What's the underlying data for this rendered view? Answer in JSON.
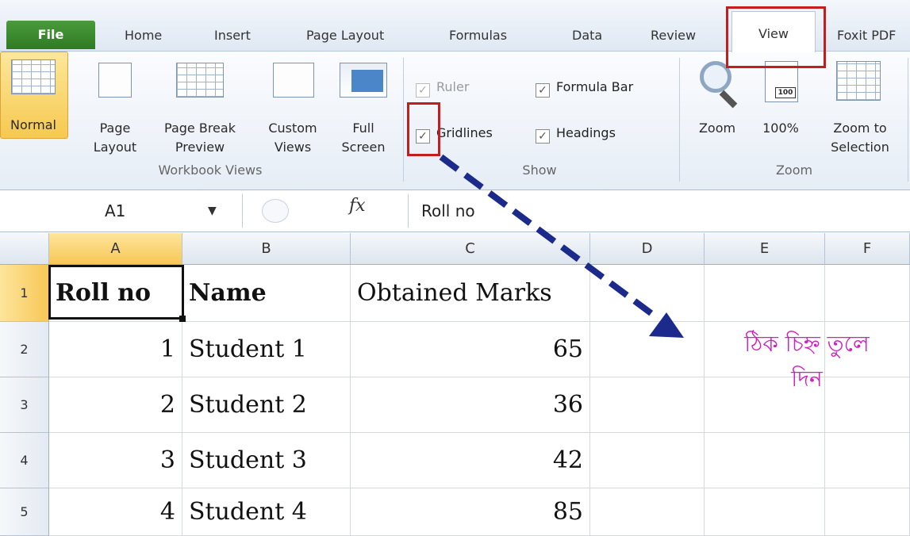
{
  "tabs": {
    "file": "File",
    "home": "Home",
    "insert": "Insert",
    "page_layout": "Page Layout",
    "formulas": "Formulas",
    "data": "Data",
    "review": "Review",
    "view": "View",
    "foxit": "Foxit PDF"
  },
  "ribbon": {
    "workbook_views": {
      "group_label": "Workbook Views",
      "normal": "Normal",
      "page_layout_1": "Page",
      "page_layout_2": "Layout",
      "page_break_1": "Page Break",
      "page_break_2": "Preview",
      "custom_1": "Custom",
      "custom_2": "Views",
      "full_1": "Full",
      "full_2": "Screen"
    },
    "show": {
      "group_label": "Show",
      "ruler": "Ruler",
      "formula_bar": "Formula Bar",
      "gridlines": "Gridlines",
      "headings": "Headings",
      "check_mark": "✓"
    },
    "zoom": {
      "group_label": "Zoom",
      "zoom": "Zoom",
      "hundred": "100%",
      "hundred_icon_text": "100",
      "zoom_sel_1": "Zoom to",
      "zoom_sel_2": "Selection"
    }
  },
  "formula_bar": {
    "name_box": "A1",
    "fx": "fx",
    "value": "Roll no"
  },
  "sheet": {
    "columns": [
      "A",
      "B",
      "C",
      "D",
      "E",
      "F"
    ],
    "rows": [
      "1",
      "2",
      "3",
      "4",
      "5"
    ],
    "header_row": [
      "Roll no",
      "Name",
      "Obtained Marks"
    ],
    "data": [
      [
        "1",
        "Student 1",
        "65"
      ],
      [
        "2",
        "Student 2",
        "36"
      ],
      [
        "3",
        "Student 3",
        "42"
      ],
      [
        "4",
        "Student 4",
        "85"
      ]
    ]
  },
  "annotation": {
    "line1": "ঠিক চিহ্ন  তুলে",
    "line2": "দিন"
  },
  "colors": {
    "highlight": "#c41d1d",
    "arrow": "#1c2a8c",
    "annotation": "#d21ec0"
  }
}
